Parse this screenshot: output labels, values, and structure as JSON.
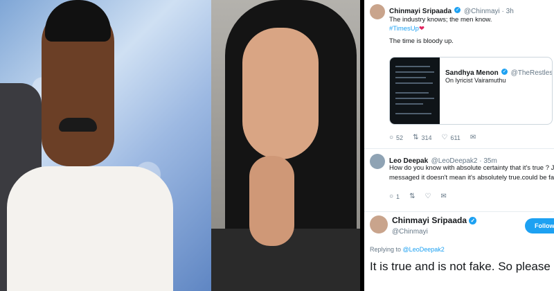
{
  "tweet1": {
    "name": "Chinmayi Sripaada",
    "handle": "@Chinmayi · 3h",
    "line1": "The industry knows; the men know.",
    "hashtag": "#TimesUp",
    "line3": "The time is bloody up.",
    "quote": {
      "name": "Sandhya Menon",
      "handle": "@TheRestlessQuil",
      "text": "On lyricist Vairamuthu"
    },
    "replies": "52",
    "retweets": "314",
    "likes": "611"
  },
  "tweet2": {
    "name": "Leo Deepak",
    "handle": "@LeoDeepak2 · 35m",
    "line1": "How do you know with absolute certainty that it's true ? Just because so",
    "line2": "messaged it doesn't mean it's absolutely true.could be fake also",
    "replies": "1"
  },
  "tweet3": {
    "name": "Chinmayi Sripaada",
    "handle": "@Chinmayi",
    "follow_label": "Following",
    "replying_prefix": "Replying to",
    "replying_mention": "@LeoDeepak2",
    "text": "It is true and is not fake. So please"
  },
  "icons": {
    "verified": "verified-badge-icon",
    "reply": "reply-icon",
    "retweet": "retweet-icon",
    "like": "heart-icon",
    "message": "message-icon"
  },
  "colors": {
    "link": "#1da1f2",
    "text": "#14171a",
    "muted": "#657786"
  }
}
